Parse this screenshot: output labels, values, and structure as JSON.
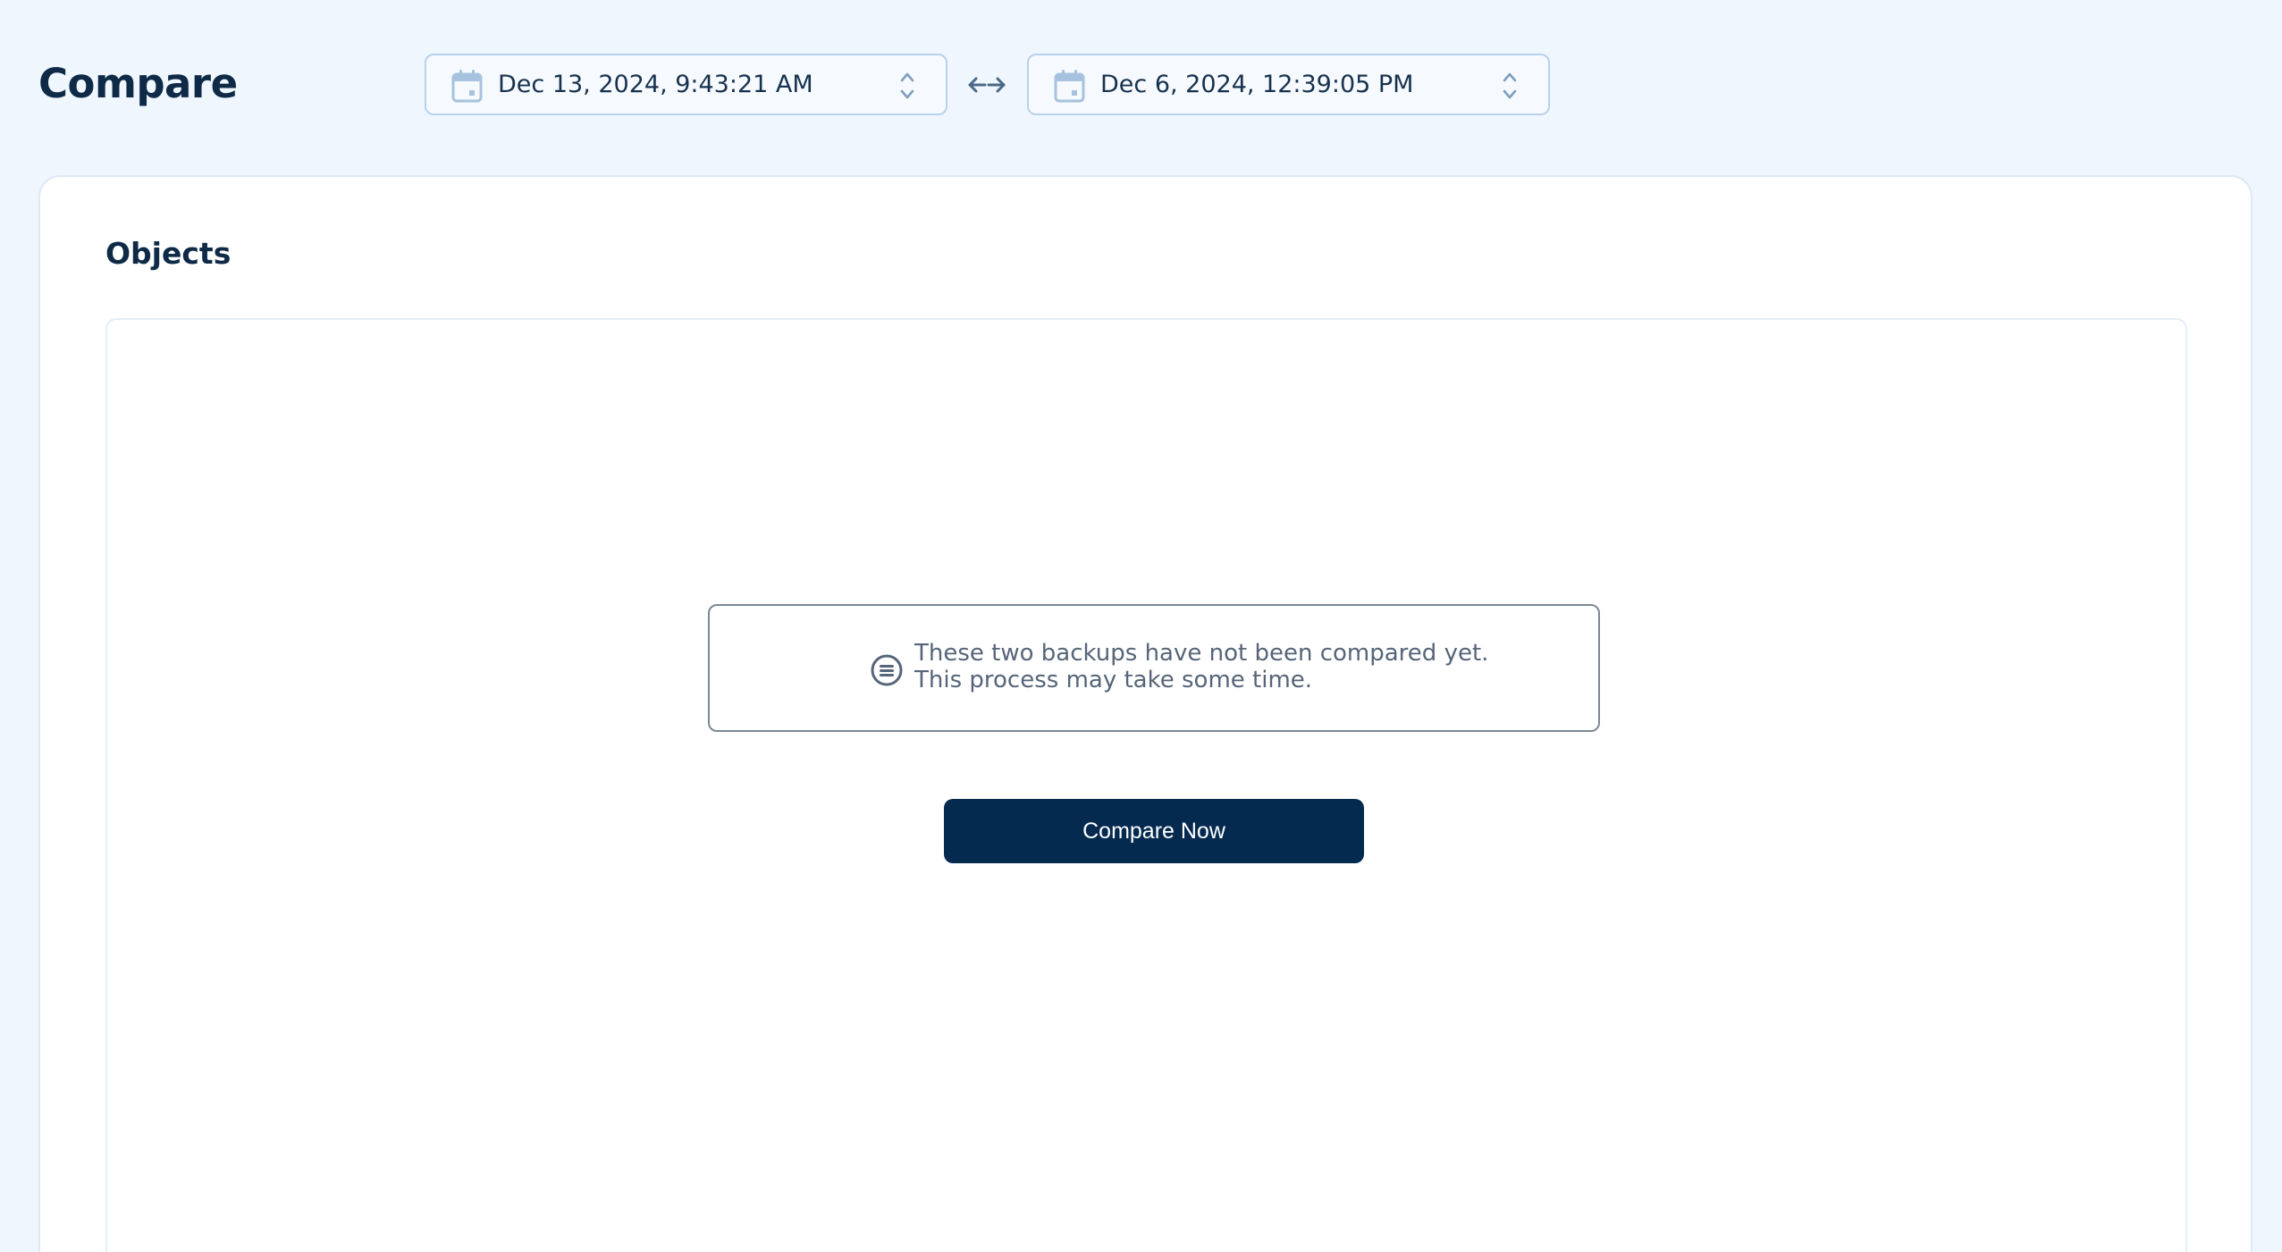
{
  "header": {
    "title": "Compare",
    "from_date": "Dec 13, 2024, 9:43:21 AM",
    "to_date": "Dec 6, 2024, 12:39:05 PM"
  },
  "objects": {
    "title": "Objects",
    "notice_line1": "These two backups have not been compared yet.",
    "notice_line2": "This process may take some time.",
    "compare_button": "Compare Now"
  },
  "icons": {
    "calendar": "calendar-icon",
    "updown": "chevron-up-down-icon",
    "swap": "swap-arrows-icon",
    "notice": "list-circle-icon"
  },
  "colors": {
    "background": "#eff6fd",
    "accent": "#052a4f",
    "border": "#b7d2ec",
    "muted_text": "#566579"
  }
}
